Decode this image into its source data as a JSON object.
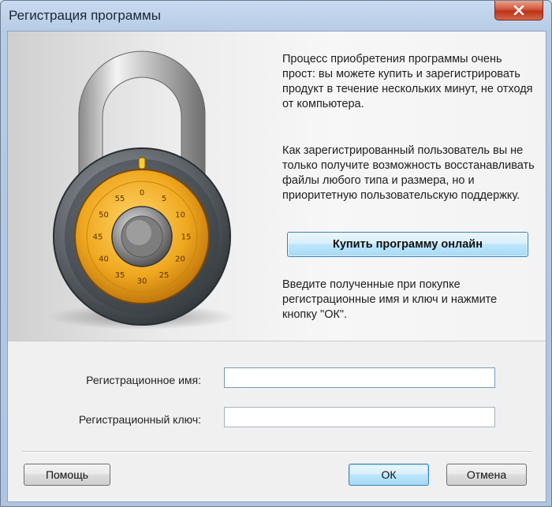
{
  "window": {
    "title": "Регистрация программы"
  },
  "description": {
    "paragraph1": "Процесс приобретения программы очень прост: вы можете купить и зарегистрировать продукт в течение нескольких минут, не отходя от компьютера.",
    "paragraph2": "Как зарегистрированный пользователь вы не только получите возможность восстанавливать файлы любого типа и размера, но и приоритетную пользовательскую поддержку.",
    "paragraph3": "Введите полученные при покупке регистрационные имя и ключ и нажмите кнопку \"ОК\"."
  },
  "buy_button": {
    "label": "Купить программу онлайн"
  },
  "form": {
    "name_label": "Регистрационное имя:",
    "name_value": "",
    "key_label": "Регистрационный ключ:",
    "key_value": ""
  },
  "buttons": {
    "help": "Помощь",
    "ok": "ОК",
    "cancel": "Отмена"
  },
  "lock": {
    "dial_numbers": [
      "0",
      "5",
      "10",
      "15",
      "20",
      "25",
      "30",
      "35",
      "40",
      "45",
      "50",
      "55"
    ]
  },
  "icons": {
    "close": "close-icon",
    "illustration": "padlock-icon"
  },
  "colors": {
    "accent_button": "#bee6fd",
    "close_button": "#c7432a",
    "dial_gold": "#f0a820"
  }
}
